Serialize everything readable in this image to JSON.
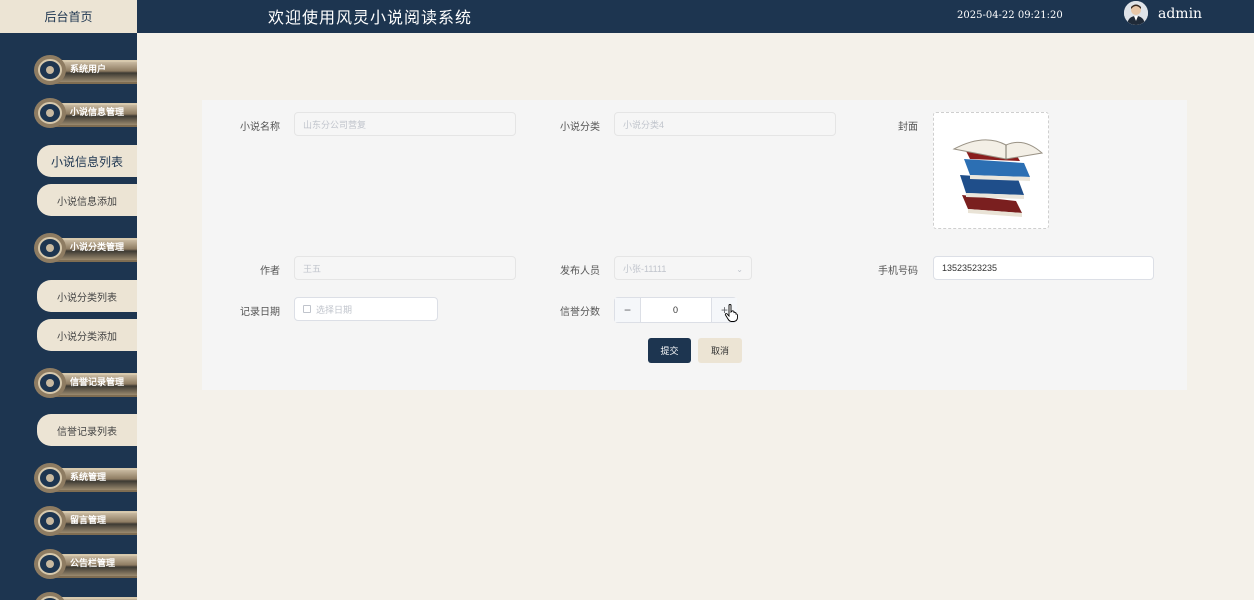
{
  "header": {
    "home_tab": "后台首页",
    "title": "欢迎使用风灵小说阅读系统",
    "datetime": "2025-04-22 09:21:20",
    "username": "admin"
  },
  "sidebar": {
    "items": [
      {
        "label": "系统用户"
      },
      {
        "label": "小说信息管理"
      },
      {
        "label": "小说信息列表"
      },
      {
        "label": "小说信息添加"
      },
      {
        "label": "小说分类管理"
      },
      {
        "label": "小说分类列表"
      },
      {
        "label": "小说分类添加"
      },
      {
        "label": "信誉记录管理"
      },
      {
        "label": "信誉记录列表"
      },
      {
        "label": "系统管理"
      },
      {
        "label": "留言管理"
      },
      {
        "label": "公告栏管理"
      }
    ]
  },
  "form": {
    "novel_name_label": "小说名称",
    "novel_name_value": "山东分公司营复",
    "category_label": "小说分类",
    "category_value": "小说分类4",
    "cover_label": "封面",
    "author_label": "作者",
    "author_value": "王五",
    "publisher_label": "发布人员",
    "publisher_value": "小张-11111",
    "phone_label": "手机号码",
    "phone_value": "13523523235",
    "date_label": "记录日期",
    "date_placeholder": "选择日期",
    "score_label": "信誉分数",
    "score_value": "0",
    "minus_label": "−",
    "plus_label": "+",
    "submit_label": "提交",
    "cancel_label": "取消"
  },
  "colors": {
    "navy": "#1d3550",
    "beige": "#ece4d4",
    "background": "#f4f1ea"
  }
}
